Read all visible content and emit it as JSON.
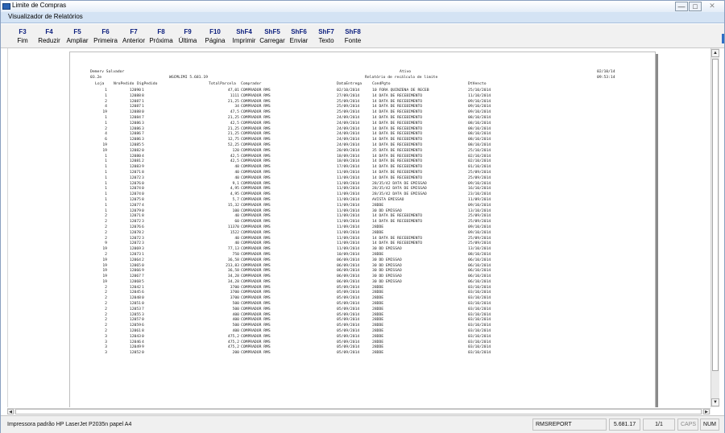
{
  "window": {
    "title": "Limite de Compras",
    "controls": {
      "minimize_icon": "minimize-icon",
      "maximize_icon": "maximize-icon",
      "close_icon": "close-icon"
    }
  },
  "viewer": {
    "title": "Visualizador de Relatórios"
  },
  "toolbar": {
    "buttons": [
      {
        "key": "F3",
        "label": "Fim"
      },
      {
        "key": "F4",
        "label": "Reduzir"
      },
      {
        "key": "F5",
        "label": "Ampliar"
      },
      {
        "key": "F6",
        "label": "Primeira"
      },
      {
        "key": "F7",
        "label": "Anterior"
      },
      {
        "key": "F8",
        "label": "Próxima"
      },
      {
        "key": "F9",
        "label": "Última"
      },
      {
        "key": "F10",
        "label": "Página"
      },
      {
        "key": "ShF4",
        "label": "Imprimir"
      },
      {
        "key": "ShF5",
        "label": "Carregar"
      },
      {
        "key": "ShF6",
        "label": "Enviar"
      },
      {
        "key": "ShF7",
        "label": "Texto"
      },
      {
        "key": "ShF8",
        "label": "Fonte"
      }
    ]
  },
  "report": {
    "header": {
      "left1": "Demerv Salvador",
      "center1": "Ativo",
      "right1": "02/10/14",
      "left2": "03.2e",
      "program": "WGCMLIMI 5.681.19",
      "center2": "Relatório de recálculo de limite",
      "right2": "09:53:14"
    },
    "columns": {
      "loja": "Loja",
      "nro_pedido": "NroPedido",
      "dig_pedido": "DigPedido",
      "total_parcela": "TotalParcela",
      "comprador": "Comprador",
      "data_entrega": "DataEntrega",
      "cond_pgto": "CondPgto",
      "dt_vencto": "DtVencto"
    },
    "rows": [
      [
        "1",
        "12090",
        "1",
        "47,01",
        "COMPRADOR RMS",
        "02/10/2014",
        "10 FORA QUINZENA DE RECEB",
        "25/10/2014"
      ],
      [
        "1",
        "12088",
        "8",
        "1111",
        "COMPRADOR RMS",
        "27/09/2014",
        "14 DATA DE RECEBIMENTO",
        "11/10/2014"
      ],
      [
        "2",
        "12087",
        "1",
        "21,25",
        "COMPRADOR RMS",
        "25/09/2014",
        "14 DATA DE RECEBIMENTO",
        "09/10/2014"
      ],
      [
        "4",
        "12087",
        "1",
        "34",
        "COMPRADOR RMS",
        "25/09/2014",
        "14 DATA DE RECEBIMENTO",
        "09/10/2014"
      ],
      [
        "19",
        "12088",
        "0",
        "47,5",
        "COMPRADOR RMS",
        "25/09/2014",
        "14 DATA DE RECEBIMENTO",
        "09/10/2014"
      ],
      [
        "1",
        "12084",
        "7",
        "21,25",
        "COMPRADOR RMS",
        "24/09/2014",
        "14 DATA DE RECEBIMENTO",
        "08/10/2014"
      ],
      [
        "1",
        "12086",
        "3",
        "42,5",
        "COMPRADOR RMS",
        "24/09/2014",
        "14 DATA DE RECEBIMENTO",
        "08/10/2014"
      ],
      [
        "2",
        "12086",
        "3",
        "21,25",
        "COMPRADOR RMS",
        "24/09/2014",
        "14 DATA DE RECEBIMENTO",
        "08/10/2014"
      ],
      [
        "4",
        "12086",
        "7",
        "21,25",
        "COMPRADOR RMS",
        "24/09/2014",
        "14 DATA DE RECEBIMENTO",
        "08/10/2014"
      ],
      [
        "6",
        "12086",
        "3",
        "12,75",
        "COMPRADOR RMS",
        "24/09/2014",
        "14 DATA DE RECEBIMENTO",
        "08/10/2014"
      ],
      [
        "19",
        "12085",
        "5",
        "52,25",
        "COMPRADOR RMS",
        "24/09/2014",
        "14 DATA DE RECEBIMENTO",
        "08/10/2014"
      ],
      [
        "19",
        "12082",
        "0",
        "120",
        "COMPRADOR RMS",
        "20/09/2014",
        "35 DATA DE RECEBIMENTO",
        "25/10/2014"
      ],
      [
        "1",
        "12080",
        "4",
        "42,5",
        "COMPRADOR RMS",
        "18/09/2014",
        "14 DATA DE RECEBIMENTO",
        "02/10/2014"
      ],
      [
        "1",
        "12081",
        "2",
        "42,5",
        "COMPRADOR RMS",
        "18/09/2014",
        "14 DATA DE RECEBIMENTO",
        "02/10/2014"
      ],
      [
        "1",
        "12083",
        "9",
        "48",
        "COMPRADOR RMS",
        "17/09/2014",
        "14 DATA DE RECEBIMENTO",
        "01/10/2014"
      ],
      [
        "1",
        "12071",
        "8",
        "40",
        "COMPRADOR RMS",
        "11/09/2014",
        "14 DATA DE RECEBIMENTO",
        "25/09/2014"
      ],
      [
        "1",
        "12072",
        "3",
        "40",
        "COMPRADOR RMS",
        "11/09/2014",
        "14 DATA DE RECEBIMENTO",
        "25/09/2014"
      ],
      [
        "1",
        "12076",
        "0",
        "9,1",
        "COMPRADOR RMS",
        "11/09/2014",
        "28/35/42 DATA DE EMISSAO",
        "09/10/2014"
      ],
      [
        "1",
        "12074",
        "0",
        "4,95",
        "COMPRADOR RMS",
        "11/09/2014",
        "28/35/42 DATA DE EMISSAO",
        "16/10/2014"
      ],
      [
        "1",
        "12074",
        "0",
        "4,95",
        "COMPRADOR RMS",
        "11/09/2014",
        "28/35/42 DATA DE EMISSAO",
        "23/10/2014"
      ],
      [
        "1",
        "12075",
        "8",
        "5,7",
        "COMPRADOR RMS",
        "11/09/2014",
        "AVISTA EMISSAO",
        "11/09/2014"
      ],
      [
        "1",
        "12077",
        "4",
        "15,32",
        "COMPRADOR RMS",
        "11/09/2014",
        "28DDE",
        "09/10/2014"
      ],
      [
        "1",
        "12079",
        "0",
        "100",
        "COMPRADOR RMS",
        "11/09/2014",
        "30 DD EMISSAO",
        "13/10/2014"
      ],
      [
        "2",
        "12071",
        "8",
        "40",
        "COMPRADOR RMS",
        "11/09/2014",
        "14 DATA DE RECEBIMENTO",
        "25/09/2014"
      ],
      [
        "2",
        "12072",
        "3",
        "60",
        "COMPRADOR RMS",
        "11/09/2014",
        "14 DATA DE RECEBIMENTO",
        "25/09/2014"
      ],
      [
        "2",
        "12076",
        "6",
        "11370",
        "COMPRADOR RMS",
        "11/09/2014",
        "28DDE",
        "09/10/2014"
      ],
      [
        "2",
        "12078",
        "2",
        "1522",
        "COMPRADOR RMS",
        "11/09/2014",
        "28DDE",
        "09/10/2014"
      ],
      [
        "2",
        "12072",
        "3",
        "40",
        "COMPRADOR RMS",
        "11/09/2014",
        "14 DATA DE RECEBIMENTO",
        "25/09/2014"
      ],
      [
        "9",
        "12072",
        "3",
        "40",
        "COMPRADOR RMS",
        "11/09/2014",
        "14 DATA DE RECEBIMENTO",
        "25/09/2014"
      ],
      [
        "19",
        "12069",
        "3",
        "77,13",
        "COMPRADOR RMS",
        "11/09/2014",
        "30 DD EMISSAO",
        "13/10/2014"
      ],
      [
        "2",
        "12073",
        "1",
        "750",
        "COMPRADOR RMS",
        "10/09/2014",
        "28DDE",
        "08/10/2014"
      ],
      [
        "19",
        "12064",
        "2",
        "36,58",
        "COMPRADOR RMS",
        "06/09/2014",
        "30 DD EMISSAO",
        "06/10/2014"
      ],
      [
        "19",
        "12065",
        "0",
        "213,83",
        "COMPRADOR RMS",
        "06/09/2014",
        "30 DD EMISSAO",
        "06/10/2014"
      ],
      [
        "19",
        "12066",
        "9",
        "36,58",
        "COMPRADOR RMS",
        "06/09/2014",
        "30 DD EMISSAO",
        "06/10/2014"
      ],
      [
        "19",
        "12067",
        "7",
        "34,28",
        "COMPRADOR RMS",
        "06/09/2014",
        "30 DD EMISSAO",
        "06/10/2014"
      ],
      [
        "19",
        "12068",
        "5",
        "34,28",
        "COMPRADOR RMS",
        "06/09/2014",
        "30 DD EMISSAO",
        "06/10/2014"
      ],
      [
        "2",
        "12042",
        "1",
        "3700",
        "COMPRADOR RMS",
        "05/09/2014",
        "28DDE",
        "03/10/2014"
      ],
      [
        "2",
        "12045",
        "6",
        "3700",
        "COMPRADOR RMS",
        "05/09/2014",
        "28DDE",
        "03/10/2014"
      ],
      [
        "2",
        "12048",
        "0",
        "3700",
        "COMPRADOR RMS",
        "05/09/2014",
        "28DDE",
        "03/10/2014"
      ],
      [
        "2",
        "12051",
        "0",
        "500",
        "COMPRADOR RMS",
        "05/09/2014",
        "28DDE",
        "03/10/2014"
      ],
      [
        "2",
        "12053",
        "7",
        "500",
        "COMPRADOR RMS",
        "05/09/2014",
        "28DDE",
        "03/10/2014"
      ],
      [
        "2",
        "12055",
        "3",
        "400",
        "COMPRADOR RMS",
        "05/09/2014",
        "28DDE",
        "03/10/2014"
      ],
      [
        "2",
        "12057",
        "0",
        "400",
        "COMPRADOR RMS",
        "05/09/2014",
        "28DDE",
        "03/10/2014"
      ],
      [
        "2",
        "12059",
        "6",
        "500",
        "COMPRADOR RMS",
        "05/09/2014",
        "28DDE",
        "03/10/2014"
      ],
      [
        "2",
        "12061",
        "8",
        "400",
        "COMPRADOR RMS",
        "05/09/2014",
        "28DDE",
        "03/10/2014"
      ],
      [
        "3",
        "12043",
        "0",
        "475,2",
        "COMPRADOR RMS",
        "05/09/2014",
        "28DDE",
        "03/10/2014"
      ],
      [
        "3",
        "12046",
        "4",
        "475,2",
        "COMPRADOR RMS",
        "05/09/2014",
        "28DDE",
        "03/10/2014"
      ],
      [
        "3",
        "12049",
        "9",
        "475,2",
        "COMPRADOR RMS",
        "05/09/2014",
        "28DDE",
        "03/10/2014"
      ],
      [
        "3",
        "12052",
        "0",
        "200",
        "COMPRADOR RMS",
        "05/09/2014",
        "28DDE",
        "03/10/2014"
      ]
    ]
  },
  "statusbar": {
    "printer": "Impressora padrão HP LaserJet P2035n papel A4",
    "report": "RMSREPORT",
    "version": "5.681.17",
    "pages": "1/1",
    "caps": "CAPS",
    "num": "NUM"
  }
}
